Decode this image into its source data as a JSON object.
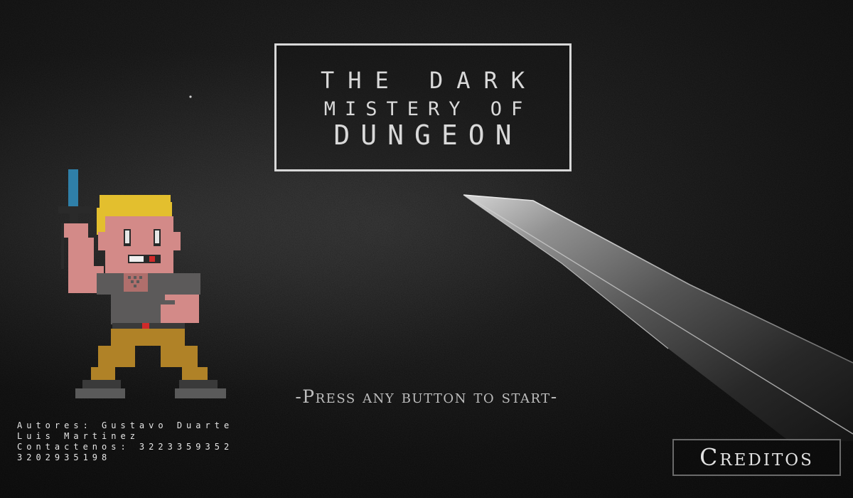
{
  "title": {
    "line1": "THE DARK",
    "line2": "MISTERY OF",
    "line3": "DUNGEON"
  },
  "prompt": {
    "press_start": "-Press any button to start-"
  },
  "authors": {
    "line1": "Autores: Gustavo Duarte",
    "line2": "Luis Martinez",
    "line3": "Contactenos: 3223359352",
    "line4": "3202935198"
  },
  "buttons": {
    "credits_label": "Creditos"
  },
  "colors": {
    "background": "#121212",
    "title_border": "#d8d8d8",
    "text": "#d9d9d9",
    "hero_hair": "#e3bf2e",
    "hero_skin": "#d38a88",
    "hero_shirt": "#5c5a5a",
    "hero_pants": "#b08227",
    "sword_blade": "#2f7fa8"
  }
}
